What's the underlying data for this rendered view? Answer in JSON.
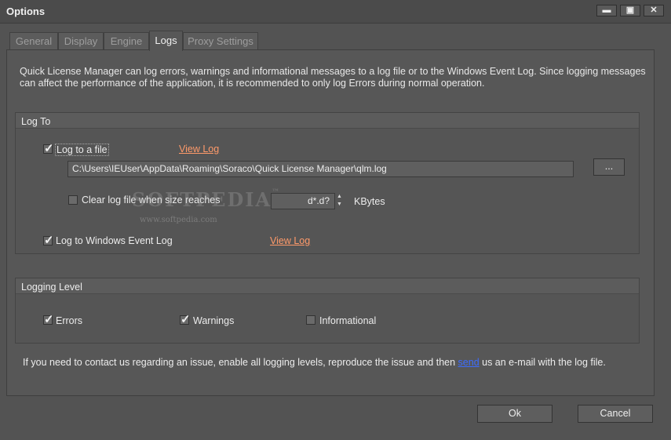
{
  "window": {
    "title": "Options",
    "minimize": "▬",
    "maximize": "▣",
    "close": "✕"
  },
  "tabs": [
    {
      "label": "General"
    },
    {
      "label": "Display"
    },
    {
      "label": "Engine"
    },
    {
      "label": "Logs"
    },
    {
      "label": "Proxy Settings"
    }
  ],
  "active_tab": "Logs",
  "description": "Quick License Manager can log errors, warnings and informational messages to a log file or to the Windows Event Log. Since logging messages can affect the performance of the application, it is recommended to only log Errors during normal operation.",
  "log_to": {
    "title": "Log To",
    "log_to_file": {
      "label": "Log to a file",
      "checked": true
    },
    "view_log_file": "View Log",
    "file_path": "C:\\Users\\IEUser\\AppData\\Roaming\\Soraco\\Quick License Manager\\qlm.log",
    "browse_label": "...",
    "clear_log": {
      "label": "Clear log file when size reaches",
      "checked": false
    },
    "size_value": "d*.d?",
    "size_unit": "KBytes",
    "log_to_event": {
      "label": "Log to Windows Event Log",
      "checked": true
    },
    "view_log_event": "View Log"
  },
  "logging_level": {
    "title": "Logging Level",
    "errors": {
      "label": "Errors",
      "checked": true
    },
    "warnings": {
      "label": "Warnings",
      "checked": true
    },
    "informational": {
      "label": "Informational",
      "checked": false
    }
  },
  "footer": {
    "before": "If you need to contact us regarding an issue, enable all logging levels, reproduce the issue and then ",
    "link": "send",
    "after": " us an e-mail with the log file."
  },
  "buttons": {
    "ok": "Ok",
    "cancel": "Cancel"
  },
  "watermark": {
    "main": "SOFTPEDIA",
    "tm": "™",
    "sub": "www.softpedia.com"
  }
}
